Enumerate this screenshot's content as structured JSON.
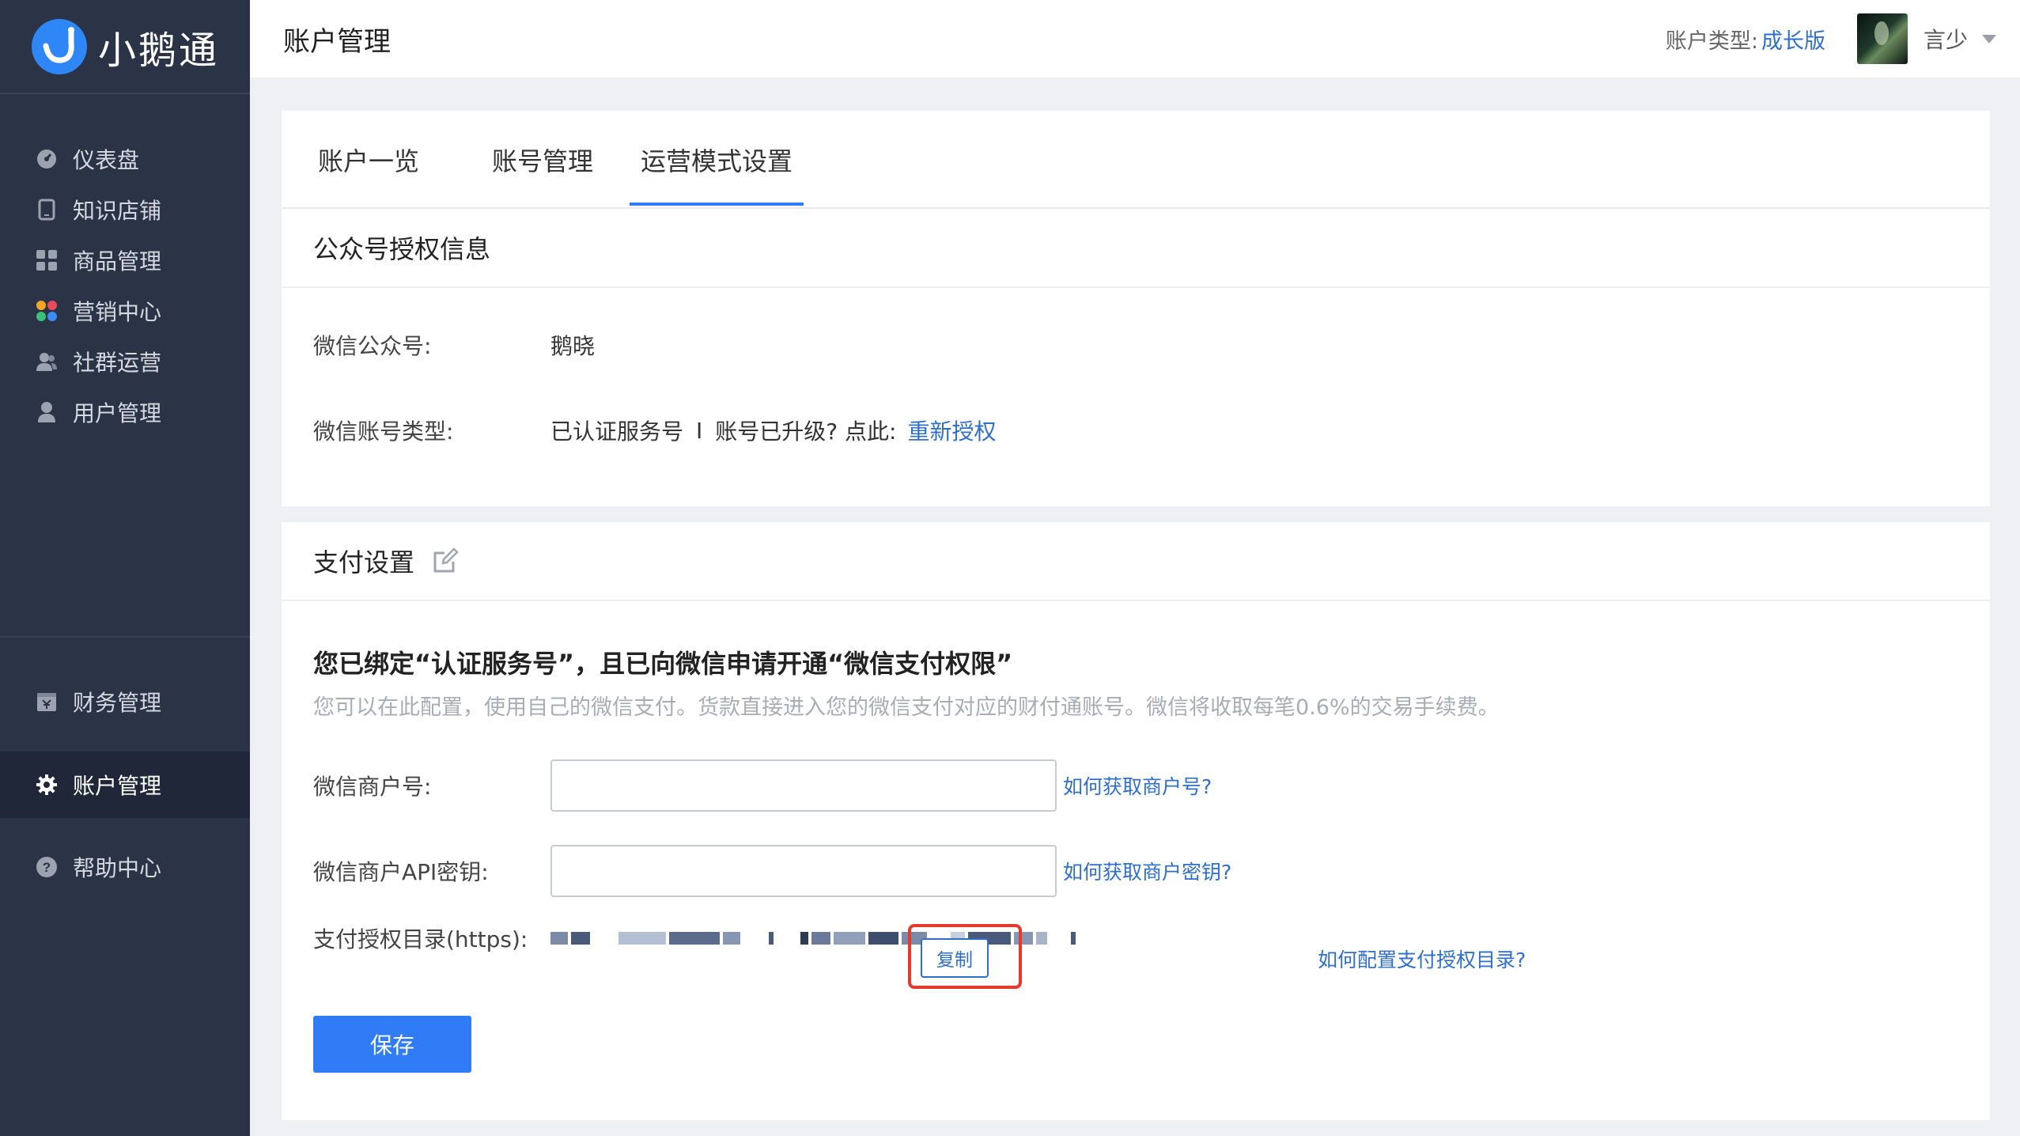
{
  "app": {
    "name": "小鹅通"
  },
  "sidebar": {
    "items": [
      {
        "label": "仪表盘",
        "icon": "dashboard-icon"
      },
      {
        "label": "知识店铺",
        "icon": "tablet-icon"
      },
      {
        "label": "商品管理",
        "icon": "grid-icon"
      },
      {
        "label": "营销中心",
        "icon": "colorful-dots-icon"
      },
      {
        "label": "社群运营",
        "icon": "group-icon"
      },
      {
        "label": "用户管理",
        "icon": "user-icon"
      },
      {
        "label": "财务管理",
        "icon": "finance-icon"
      },
      {
        "label": "账户管理",
        "icon": "gear-icon",
        "active": true
      },
      {
        "label": "帮助中心",
        "icon": "help-icon"
      }
    ]
  },
  "header": {
    "title": "账户管理",
    "account_type_label": "账户类型:",
    "account_type_value": "成长版",
    "user_name": "言少"
  },
  "tabs": [
    {
      "label": "账户一览"
    },
    {
      "label": "账号管理"
    },
    {
      "label": "运营模式设置",
      "active": true
    }
  ],
  "auth_section": {
    "title": "公众号授权信息",
    "wechat_account_label": "微信公众号:",
    "wechat_account_value": "鹅晓",
    "account_type_label": "微信账号类型:",
    "account_type_value": "已认证服务号",
    "separator": "I",
    "upgrade_text": "账号已升级? 点此:",
    "reauth_link": "重新授权"
  },
  "payment_section": {
    "title": "支付设置",
    "heading": "您已绑定“认证服务号”，且已向微信申请开通“微信支付权限”",
    "subtext": "您可以在此配置，使用自己的微信支付。货款直接进入您的微信支付对应的财付通账号。微信将收取每笔0.6%的交易手续费。",
    "merchant_id_label": "微信商户号:",
    "merchant_id_value": "",
    "merchant_id_help": "如何获取商户号?",
    "api_key_label": "微信商户API密钥:",
    "api_key_value": "",
    "api_key_help": "如何获取商户密钥?",
    "auth_dir_label": "支付授权目录(https):",
    "copy_button": "复制",
    "auth_dir_help": "如何配置支付授权目录?",
    "save_button": "保存"
  },
  "colors": {
    "sidebar_bg": "#2b3446",
    "accent": "#2f7cf6",
    "link": "#2f6fc9",
    "highlight": "#e4392b"
  }
}
